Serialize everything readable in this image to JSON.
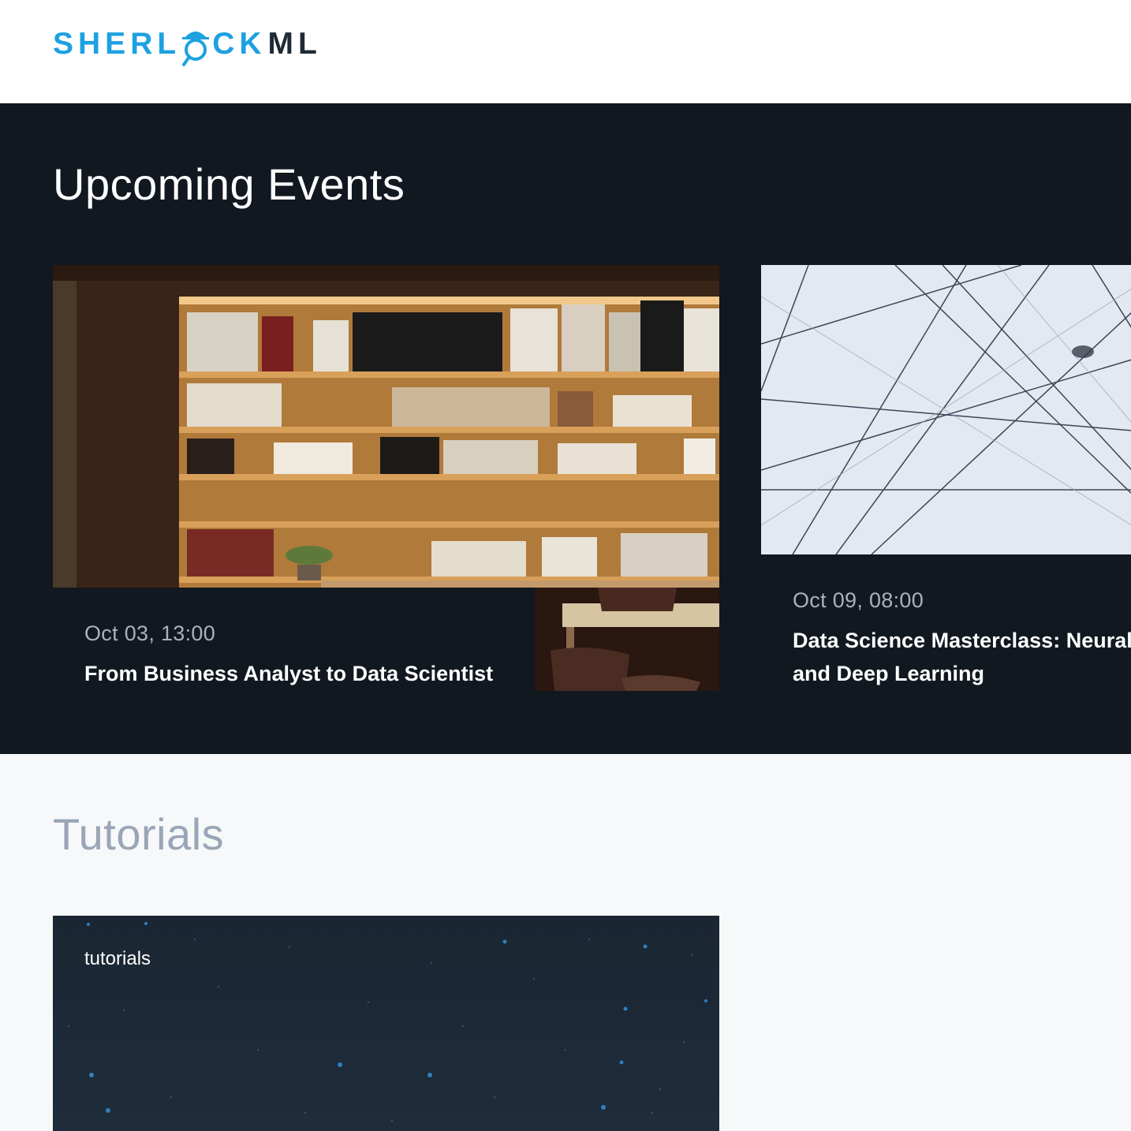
{
  "brand": {
    "logo_part1": "SHERL",
    "logo_part2": "CK",
    "logo_part3": "ML",
    "primary_color": "#1da1e2",
    "dark_color": "#1f2a36"
  },
  "events_section": {
    "title": "Upcoming Events",
    "background": "#111820",
    "cards": [
      {
        "date": "Oct 03, 13:00",
        "title": "From Business Analyst to Data Scientist",
        "image": "bookshelf-photo"
      },
      {
        "date": "Oct 09, 08:00",
        "title": "Data Science Masterclass: Neural Networks and Deep Learning",
        "image": "network-lines-photo"
      }
    ]
  },
  "tutorials_section": {
    "title": "Tutorials",
    "cards": [
      {
        "label": "tutorials",
        "image": "starfield-background"
      }
    ]
  }
}
